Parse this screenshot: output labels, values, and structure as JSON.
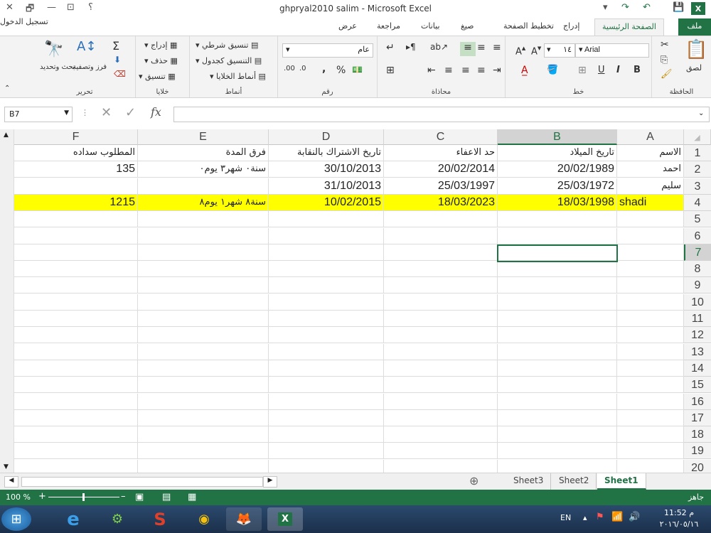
{
  "window": {
    "title": "ghpryal2010 salim - Microsoft Excel"
  },
  "qat": {
    "help": "؟"
  },
  "tabs": {
    "file": "ملف",
    "items": [
      "الصفحة الرئيسية",
      "إدراج",
      "تخطيط الصفحة",
      "صيغ",
      "بيانات",
      "مراجعة",
      "عرض"
    ],
    "login": "تسجيل الدخول"
  },
  "ribbon": {
    "clipboard": {
      "label": "الحافظة",
      "paste": "لصق"
    },
    "font": {
      "label": "خط",
      "name": "Arial",
      "size": "١٤",
      "bold": "B",
      "italic": "I",
      "underline": "U"
    },
    "alignment": {
      "label": "محاذاة"
    },
    "number": {
      "label": "رقم",
      "format": "عام",
      "percent": "%"
    },
    "styles": {
      "label": "أنماط",
      "conditional": "تنسيق شرطي",
      "table": "التنسيق كجدول",
      "cell_styles": "أنماط الخلايا"
    },
    "cells": {
      "label": "خلايا",
      "insert": "إدراج",
      "delete": "حذف",
      "format": "تنسيق"
    },
    "editing": {
      "label": "تحرير",
      "sort": "فرز وتصفية",
      "find": "بحث وتحديد"
    }
  },
  "formula_bar": {
    "name_box": "B7",
    "fx": "fx",
    "content": ""
  },
  "grid": {
    "columns": [
      "A",
      "B",
      "C",
      "D",
      "E",
      "F"
    ],
    "rows": [
      "1",
      "2",
      "3",
      "4",
      "5",
      "6",
      "7",
      "8",
      "9",
      "10",
      "11",
      "12",
      "13",
      "14",
      "15",
      "16",
      "17",
      "18",
      "19",
      "20"
    ],
    "selected_column": "B",
    "selected_row": "7",
    "header_row": [
      "الاسم",
      "تاريخ الميلاد",
      "حد الاعفاء",
      "تاريخ الاشتراك بالنقابة",
      "فرق المدة",
      "المطلوب سداده"
    ],
    "data": [
      [
        "احمد",
        "20/02/1989",
        "20/02/2014",
        "30/10/2013",
        "سنة٠ شهر٣ يوم٠",
        "135"
      ],
      [
        "سليم",
        "25/03/1972",
        "25/03/1997",
        "31/10/2013",
        "",
        ""
      ],
      [
        "shadi",
        "18/03/1998",
        "18/03/2023",
        "10/02/2015",
        "سنة٨ شهر١ يوم٨",
        "1215"
      ]
    ],
    "highlight_color": "#ffff00"
  },
  "sheets": {
    "tabs": [
      "Sheet1",
      "Sheet2",
      "Sheet3"
    ],
    "active": "Sheet1"
  },
  "status": {
    "ready": "جاهز",
    "zoom": "100 %"
  },
  "taskbar": {
    "lang": "EN",
    "time": "11:52 م",
    "date": "٢٠١٦/٠٥/١٦"
  },
  "colors": {
    "accent": "#217346"
  }
}
